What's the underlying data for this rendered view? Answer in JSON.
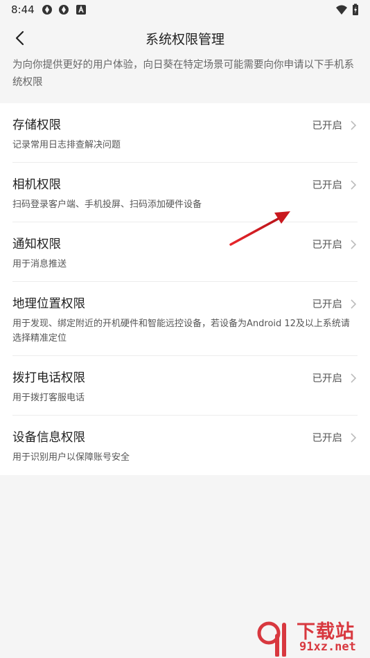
{
  "status_bar": {
    "time": "8:44"
  },
  "header": {
    "title": "系统权限管理"
  },
  "intro": "为向你提供更好的用户体验，向日葵在特定场景可能需要向你申请以下手机系统权限",
  "permissions": [
    {
      "title": "存储权限",
      "status": "已开启",
      "desc": "记录常用日志排查解决问题"
    },
    {
      "title": "相机权限",
      "status": "已开启",
      "desc": "扫码登录客户端、手机投屏、扫码添加硬件设备"
    },
    {
      "title": "通知权限",
      "status": "已开启",
      "desc": "用于消息推送"
    },
    {
      "title": "地理位置权限",
      "status": "已开启",
      "desc": "用于发现、绑定附近的开机硬件和智能远控设备，若设备为Android 12及以上系统请选择精准定位"
    },
    {
      "title": "拨打电话权限",
      "status": "已开启",
      "desc": "用于拨打客服电话"
    },
    {
      "title": "设备信息权限",
      "status": "已开启",
      "desc": "用于识别用户以保障账号安全"
    }
  ],
  "watermark": {
    "top": "下载站",
    "bottom": "91xz.net"
  },
  "colors": {
    "accent": "#d8383f",
    "background": "#f5f5f5",
    "card": "#ffffff"
  }
}
